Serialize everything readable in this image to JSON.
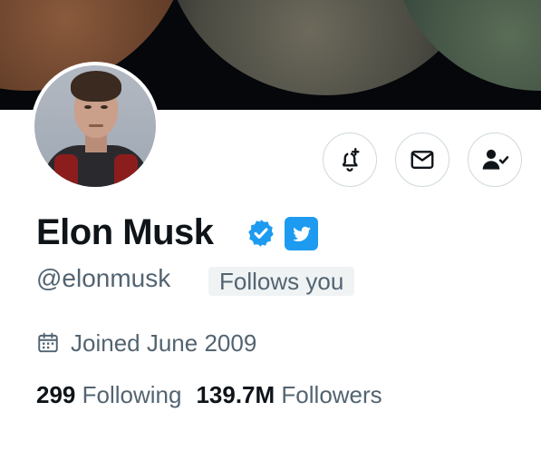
{
  "profile": {
    "name": "Elon Musk",
    "handle": "@elonmusk",
    "follows_you": "Follows you",
    "joined": "Joined June 2009",
    "following_count": "299",
    "following_label": "Following",
    "followers_count": "139.7M",
    "followers_label": "Followers"
  },
  "icons": {
    "notify": "bell-plus-icon",
    "message": "envelope-icon",
    "following": "person-check-icon",
    "verified": "verified-badge-icon",
    "affiliate": "twitter-bird-icon",
    "calendar": "calendar-icon"
  },
  "colors": {
    "accent": "#1d9bf0",
    "text_primary": "#0f1419",
    "text_secondary": "#536471",
    "border": "#cfd9de",
    "badge_bg": "#eff3f4"
  }
}
